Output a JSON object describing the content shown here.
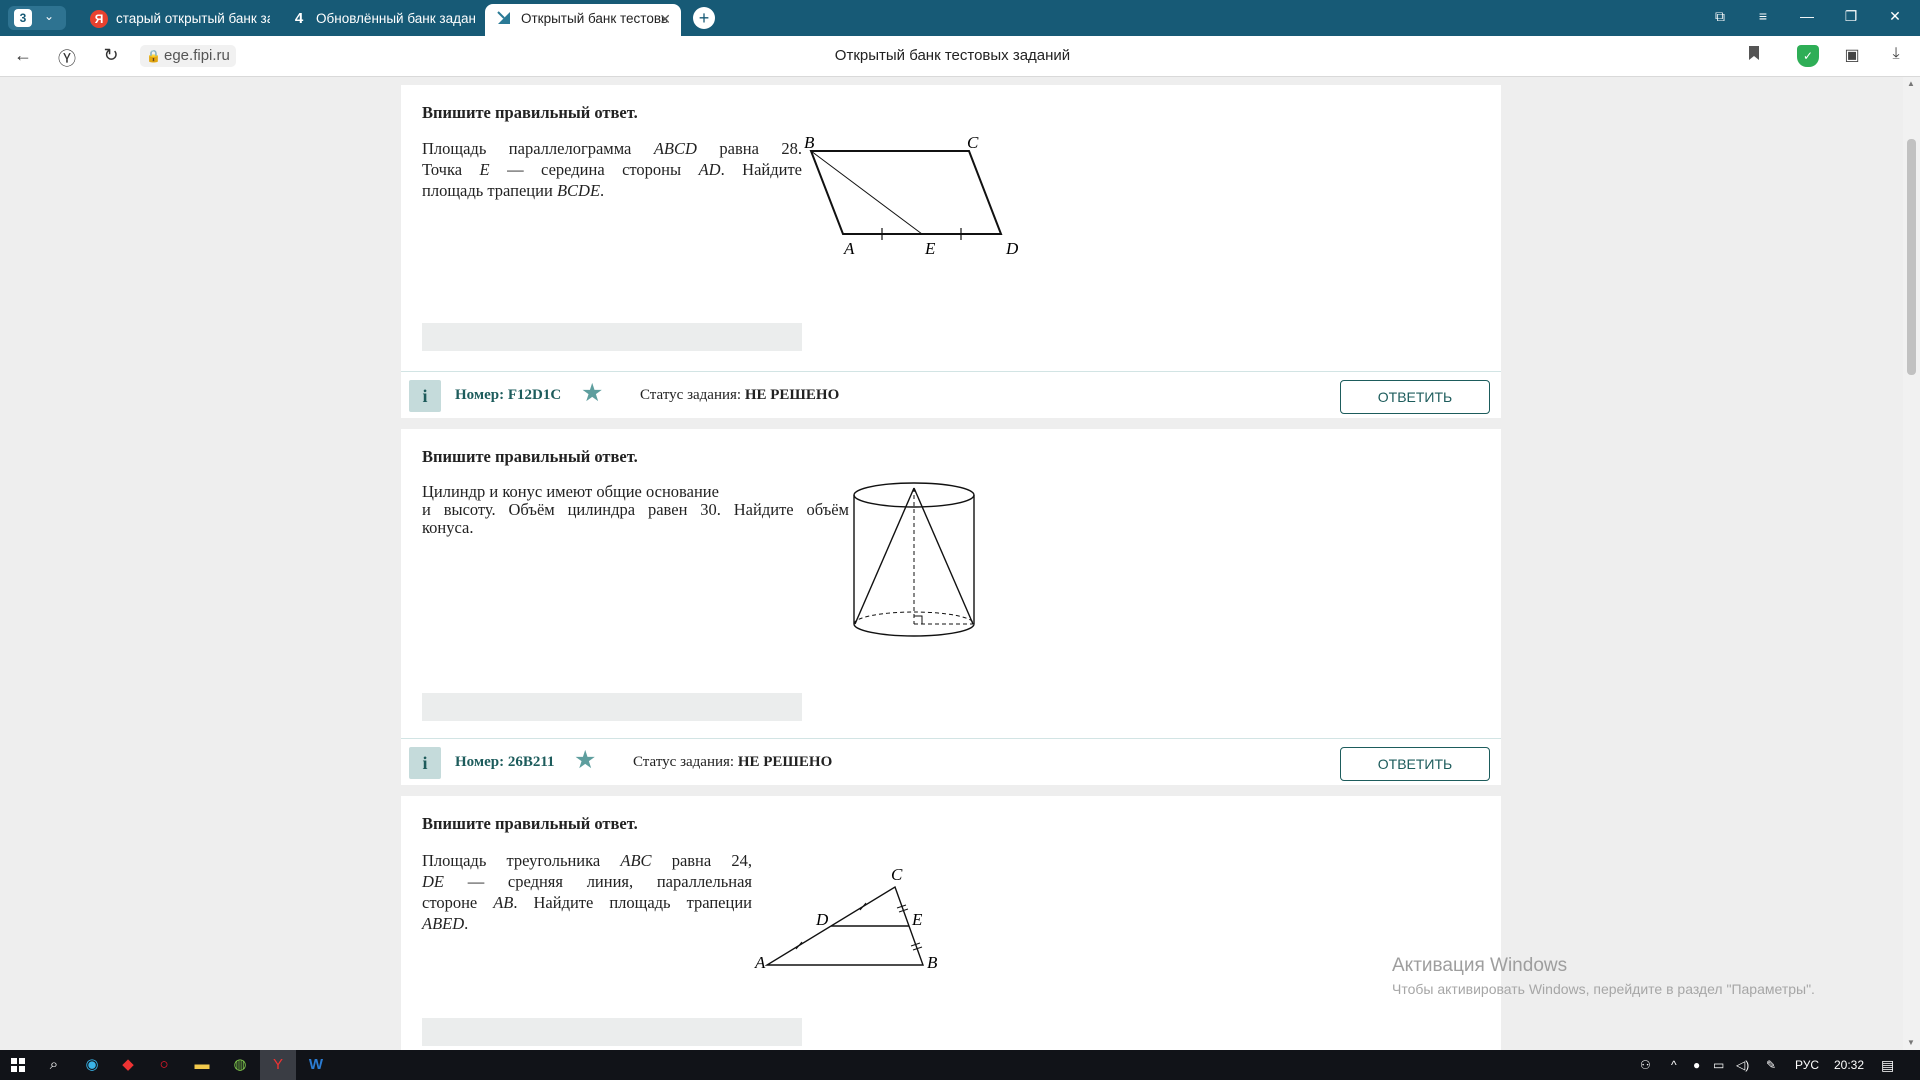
{
  "browser": {
    "tab_count": "3",
    "tabs": [
      {
        "icon": "Я",
        "label": "старый открытый банк за"
      },
      {
        "icon": "4",
        "label": "Обновлённый банк задан"
      },
      {
        "icon": "",
        "label": "Открытый банк тестовь"
      }
    ],
    "new_tab": "+",
    "url": "ege.fipi.ru",
    "page_title": "Открытый банк тестовых заданий"
  },
  "tasks": [
    {
      "heading": "Впишите правильный ответ.",
      "text_lines": [
        [
          "Площадь параллелограмма ",
          {
            "m": "ABCD"
          },
          " равна 28."
        ],
        [
          "Точка ",
          {
            "m": "E"
          },
          " — середина стороны ",
          {
            "m": "AD"
          },
          ". Найдите"
        ],
        [
          "площадь трапеции ",
          {
            "m": "BCDE"
          },
          "."
        ]
      ],
      "figure_labels": {
        "A": "A",
        "B": "B",
        "C": "C",
        "D": "D",
        "E": "E"
      },
      "number_label": "Номер: F12D1C",
      "status_label": "Статус задания:",
      "status_value": "НЕ РЕШЕНО",
      "button": "ОТВЕТИТЬ"
    },
    {
      "heading": "Впишите правильный ответ.",
      "text_lines": [
        [
          "Цилиндр и конус имеют общие основание"
        ],
        [
          "и высоту. Объём цилиндра равен 30. Найдите объём"
        ],
        [
          "конуса."
        ]
      ],
      "number_label": "Номер: 26B211",
      "status_label": "Статус задания:",
      "status_value": "НЕ РЕШЕНО",
      "button": "ОТВЕТИТЬ"
    },
    {
      "heading": "Впишите правильный ответ.",
      "text_lines": [
        [
          "Площадь треугольника ",
          {
            "m": "ABC"
          },
          " равна 24,"
        ],
        [
          {
            "m": "DE"
          },
          " — средняя линия, параллельная"
        ],
        [
          "стороне ",
          {
            "m": "AB"
          },
          ". Найдите площадь трапеции"
        ],
        [
          {
            "m": "ABED"
          },
          "."
        ]
      ],
      "figure_labels": {
        "A": "A",
        "B": "B",
        "C": "C",
        "D": "D",
        "E": "E"
      }
    }
  ],
  "watermark": {
    "title": "Активация Windows",
    "subtitle": "Чтобы активировать Windows, перейдите в раздел \"Параметры\"."
  },
  "taskbar": {
    "lang": "РУС",
    "time": "20:32"
  }
}
